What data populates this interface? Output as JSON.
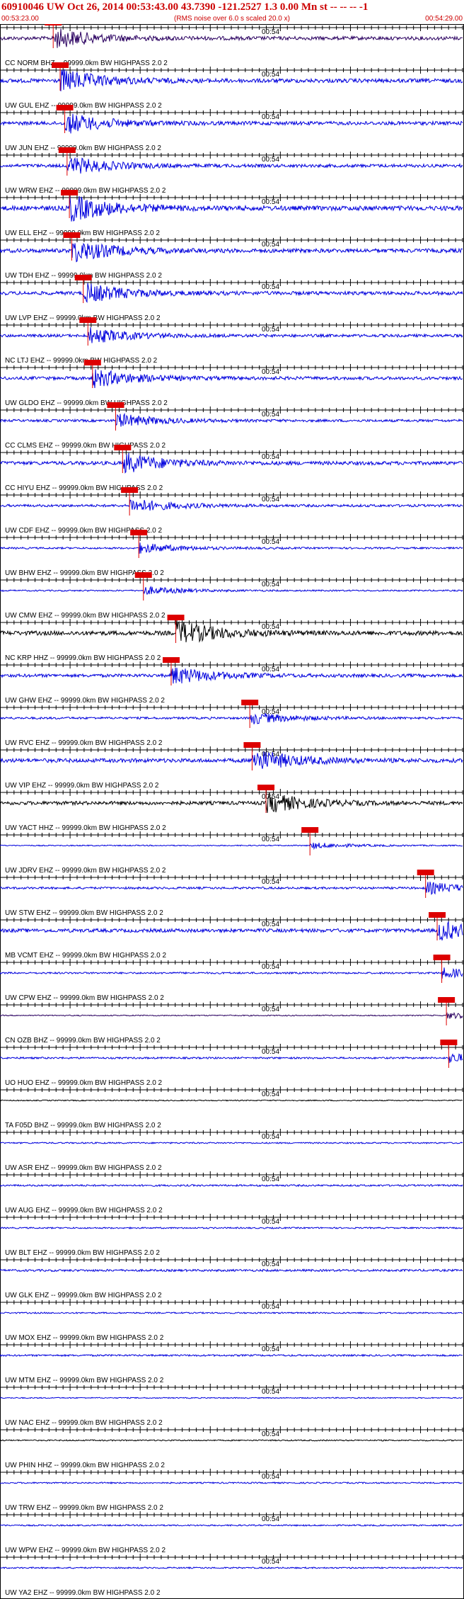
{
  "header": {
    "title": "60910046 UW Oct 26, 2014 00:53:43.00   43.7390 -121.2527  1.3 0.00 Mn st -- -- --  -1",
    "start_time": "00:53:23.00",
    "end_time": "00:54:29.00",
    "rms_note": "(RMS noise over 6.0 s scaled 20.0 x)"
  },
  "minute_label": "00:54",
  "colors": {
    "blue": "#0000dd",
    "black": "#000000",
    "purple": "#2a0060",
    "red": "#dd0000",
    "axis": "#000000"
  },
  "traces": [
    {
      "label": "CC NORM BHZ -- 99999.0km BW  HIGHPASS  2.0  2",
      "color": "purple",
      "amp": 1.0,
      "pick": 0.115
    },
    {
      "label": "UW GUL EHZ -- 99999.0km BW  HIGHPASS  2.0  2",
      "color": "blue",
      "amp": 1.1,
      "pick": 0.13
    },
    {
      "label": "UW JUN EHZ -- 99999.0km BW  HIGHPASS  2.0  2",
      "color": "blue",
      "amp": 1.0,
      "pick": 0.14
    },
    {
      "label": "UW WRW EHZ -- 99999.0km BW  HIGHPASS  2.0  2",
      "color": "blue",
      "amp": 0.9,
      "pick": 0.145
    },
    {
      "label": "UW ELL EHZ -- 99999.0km BW  HIGHPASS  2.0  2",
      "color": "blue",
      "amp": 1.3,
      "pick": 0.15
    },
    {
      "label": "UW TDH EHZ -- 99999.0km BW  HIGHPASS  2.0  2",
      "color": "blue",
      "amp": 1.1,
      "pick": 0.155
    },
    {
      "label": "UW LVP EHZ -- 99999.0km BW  HIGHPASS  2.0  2",
      "color": "blue",
      "amp": 1.0,
      "pick": 0.18
    },
    {
      "label": "NC LTJ EHZ -- 99999.0km BW  HIGHPASS  2.0  2",
      "color": "blue",
      "amp": 0.8,
      "pick": 0.19
    },
    {
      "label": "UW GLDO EHZ -- 99999.0km BW  HIGHPASS  2.0  2",
      "color": "blue",
      "amp": 0.9,
      "pick": 0.2
    },
    {
      "label": "CC CLMS EHZ -- 99999.0km BW  HIGHPASS  2.0  2",
      "color": "blue",
      "amp": 0.7,
      "pick": 0.25
    },
    {
      "label": "CC HIYU EHZ -- 99999.0km BW  HIGHPASS  2.0  2",
      "color": "blue",
      "amp": 1.0,
      "pick": 0.265
    },
    {
      "label": "UW CDF EHZ -- 99999.0km BW  HIGHPASS  2.0  2",
      "color": "blue",
      "amp": 0.7,
      "pick": 0.28
    },
    {
      "label": "UW BHW EHZ -- 99999.0km BW  HIGHPASS  2.0  2",
      "color": "blue",
      "amp": 0.5,
      "pick": 0.3
    },
    {
      "label": "UW CMW EHZ -- 99999.0km BW  HIGHPASS  2.0  2",
      "color": "blue",
      "amp": 0.4,
      "pick": 0.31
    },
    {
      "label": "NC KRP HHZ -- 99999.0km BW  HIGHPASS  2.0  2",
      "color": "black",
      "amp": 1.2,
      "pick": 0.38
    },
    {
      "label": "UW GHW EHZ -- 99999.0km BW  HIGHPASS  2.0  2",
      "color": "blue",
      "amp": 0.9,
      "pick": 0.37
    },
    {
      "label": "UW RVC EHZ -- 99999.0km BW  HIGHPASS  2.0  2",
      "color": "blue",
      "amp": 0.6,
      "pick": 0.54
    },
    {
      "label": "UW VIP EHZ -- 99999.0km BW  HIGHPASS  2.0  2",
      "color": "blue",
      "amp": 1.1,
      "pick": 0.545
    },
    {
      "label": "UW YACT HHZ -- 99999.0km BW  HIGHPASS  2.0  2",
      "color": "black",
      "amp": 1.0,
      "pick": 0.575
    },
    {
      "label": "UW JDRV EHZ -- 99999.0km BW  HIGHPASS  2.0  2",
      "color": "blue",
      "amp": 0.3,
      "pick": 0.67
    },
    {
      "label": "UW STW EHZ -- 99999.0km BW  HIGHPASS  2.0  2",
      "color": "blue",
      "amp": 0.6,
      "pick": 0.92
    },
    {
      "label": "MB VCMT EHZ -- 99999.0km BW  HIGHPASS  2.0  2",
      "color": "blue",
      "amp": 1.0,
      "pick": 0.945
    },
    {
      "label": "UW CPW EHZ -- 99999.0km BW  HIGHPASS  2.0  2",
      "color": "blue",
      "amp": 0.5,
      "pick": 0.955
    },
    {
      "label": "CN OZB BHZ -- 99999.0km BW  HIGHPASS  2.0  2",
      "color": "purple",
      "amp": 0.3,
      "pick": 0.965
    },
    {
      "label": "UO HUO EHZ -- 99999.0km BW  HIGHPASS  2.0  2",
      "color": "blue",
      "amp": 0.5,
      "pick": 0.97
    },
    {
      "label": "TA F05D BHZ -- 99999.0km BW  HIGHPASS  2.0  2",
      "color": "black",
      "amp": 0.3,
      "pick": null
    },
    {
      "label": "UW ASR EHZ -- 99999.0km BW  HIGHPASS  2.0  2",
      "color": "blue",
      "amp": 0.4,
      "pick": null
    },
    {
      "label": "UW AUG EHZ -- 99999.0km BW  HIGHPASS  2.0  2",
      "color": "blue",
      "amp": 0.5,
      "pick": null
    },
    {
      "label": "UW BLT EHZ -- 99999.0km BW  HIGHPASS  2.0  2",
      "color": "blue",
      "amp": 0.4,
      "pick": null
    },
    {
      "label": "UW GLK EHZ -- 99999.0km BW  HIGHPASS  2.0  2",
      "color": "blue",
      "amp": 0.6,
      "pick": null
    },
    {
      "label": "UW MOX EHZ -- 99999.0km BW  HIGHPASS  2.0  2",
      "color": "blue",
      "amp": 0.4,
      "pick": null
    },
    {
      "label": "UW MTM EHZ -- 99999.0km BW  HIGHPASS  2.0  2",
      "color": "blue",
      "amp": 0.5,
      "pick": null
    },
    {
      "label": "UW NAC EHZ -- 99999.0km BW  HIGHPASS  2.0  2",
      "color": "blue",
      "amp": 0.3,
      "pick": null
    },
    {
      "label": "UW PHIN HHZ -- 99999.0km BW  HIGHPASS  2.0  2",
      "color": "black",
      "amp": 0.35,
      "pick": null
    },
    {
      "label": "UW TRW EHZ -- 99999.0km BW  HIGHPASS  2.0  2",
      "color": "blue",
      "amp": 0.4,
      "pick": null
    },
    {
      "label": "UW WPW EHZ -- 99999.0km BW  HIGHPASS  2.0  2",
      "color": "blue",
      "amp": 0.4,
      "pick": null
    },
    {
      "label": "UW YA2 EHZ -- 99999.0km BW  HIGHPASS  2.0  2",
      "color": "blue",
      "amp": 0.4,
      "pick": null
    }
  ]
}
